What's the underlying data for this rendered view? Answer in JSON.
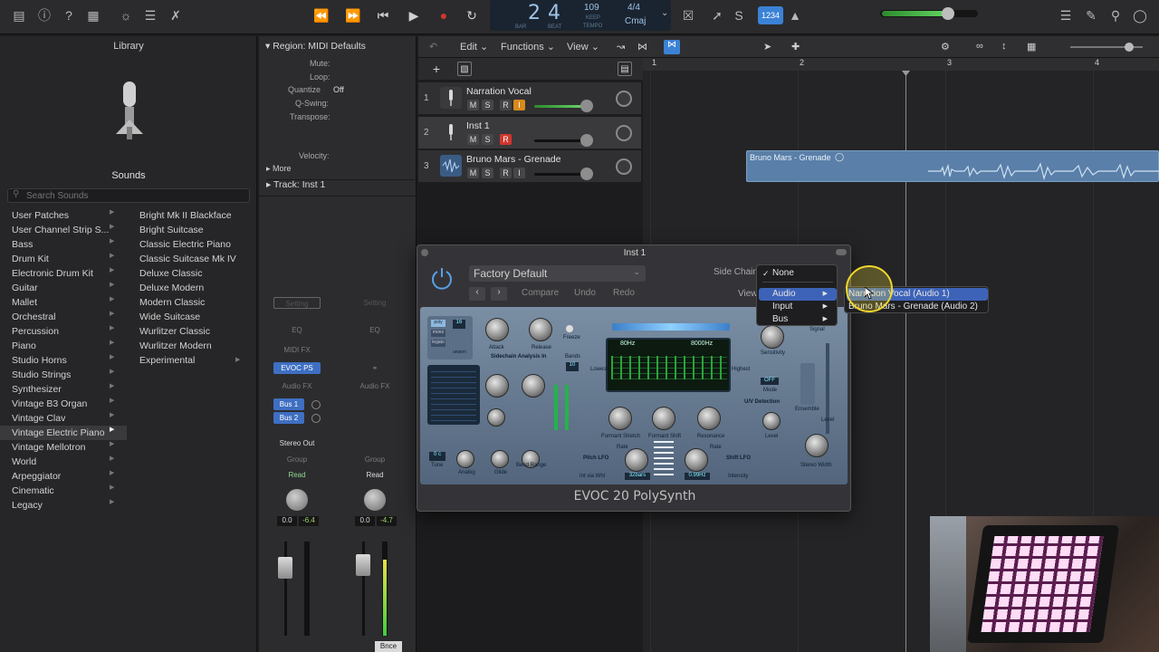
{
  "transport": {
    "bar": "2",
    "beat": "4",
    "bar_label": "BAR",
    "beat_label": "BEAT",
    "tempo": "109",
    "tempo_mode": "KEEP",
    "tempo_label": "TEMPO",
    "time_sig": "4/4",
    "key": "Cmaj",
    "counter_mode": "1234"
  },
  "library": {
    "title": "Library",
    "sounds_label": "Sounds",
    "search_placeholder": "Search Sounds",
    "categories": [
      "User Patches",
      "User Channel Strip S...",
      "Bass",
      "Drum Kit",
      "Electronic Drum Kit",
      "Guitar",
      "Mallet",
      "Orchestral",
      "Percussion",
      "Piano",
      "Studio Horns",
      "Studio Strings",
      "Synthesizer",
      "Vintage B3 Organ",
      "Vintage Clav",
      "Vintage Electric Piano",
      "Vintage Mellotron",
      "World",
      "Arpeggiator",
      "Cinematic",
      "Legacy"
    ],
    "patches": [
      "Bright Mk II Blackface",
      "Bright Suitcase",
      "Classic Electric Piano",
      "Classic Suitcase Mk IV",
      "Deluxe Classic",
      "Deluxe Modern",
      "Modern Classic",
      "Wide Suitcase",
      "Wurlitzer Classic",
      "Wurlitzer Modern",
      "Experimental"
    ]
  },
  "inspector": {
    "region_title": "Region: MIDI Defaults",
    "mute": "Mute:",
    "loop": "Loop:",
    "quantize": "Quantize",
    "quantize_value": "Off",
    "qswing": "Q-Swing:",
    "transpose": "Transpose:",
    "velocity": "Velocity:",
    "more": "More",
    "track_title": "Track:  Inst 1"
  },
  "strips": {
    "setting": "Setting",
    "eq": "EQ",
    "midi_fx": "MIDI FX",
    "instrument": "EVOC PS",
    "audio_fx": "Audio FX",
    "bus1": "Bus 1",
    "bus2": "Bus 2",
    "output": "Stereo Out",
    "group": "Group",
    "read": "Read",
    "left_pan": "0.0",
    "left_peak": "-6.4",
    "right_pan": "0.0",
    "right_peak": "-4.7",
    "bounce": "Bnce"
  },
  "tracks_menu": {
    "edit": "Edit",
    "functions": "Functions",
    "view": "View"
  },
  "tracks": [
    {
      "num": "1",
      "name": "Narration Vocal",
      "m": "M",
      "s": "S",
      "r": "R",
      "i": "I"
    },
    {
      "num": "2",
      "name": "Inst 1",
      "m": "M",
      "s": "S",
      "r": "R"
    },
    {
      "num": "3",
      "name": "Bruno Mars - Grenade",
      "m": "M",
      "s": "S",
      "r": "R",
      "i": "I"
    }
  ],
  "ruler": [
    "1",
    "2",
    "3",
    "4"
  ],
  "region": {
    "name": "Bruno Mars - Grenade"
  },
  "plugin": {
    "window_title": "Inst 1",
    "preset": "Factory Default",
    "compare": "Compare",
    "undo": "Undo",
    "redo": "Redo",
    "side_chain": "Side Chain:",
    "view": "View",
    "name": "EVOC 20 PolySynth",
    "labels": {
      "attack": "Attack",
      "release": "Release",
      "freeze": "Freeze",
      "bands": "Bands",
      "bands_value": "10",
      "lowest": "Lowest",
      "highest": "Highest",
      "low_freq": "80Hz",
      "high_freq": "8000Hz",
      "sensitivity": "Sensitivity",
      "signal": "Signal",
      "off": "OFF",
      "mode": "Mode",
      "uv_detection": "U/V Detection",
      "level": "Level",
      "ensemble": "Ensemble",
      "formant_stretch": "Formant Stretch",
      "formant_shift": "Formant Shift",
      "resonance": "Resonance",
      "pitch_lfo": "Pitch LFO",
      "shift_lfo": "Shift LFO",
      "rate": "Rate",
      "intensity": "Intensity",
      "stereo_width": "Stereo Width",
      "sidechain_in": "Sidechain Analysis In",
      "voices": "16",
      "bars_32": "32bars",
      "hz_099": "0.99Hz",
      "glide": "Glide",
      "bend_range": "Bend Range",
      "tune": "Tune",
      "analog": "Analog",
      "c0": "0 c",
      "int_via_whl": "Int via Whl",
      "poly": "poly",
      "mono": "mono",
      "legato": "legato",
      "unison": "unison"
    }
  },
  "sidechain_menu": {
    "none": "None",
    "audio": "Audio",
    "input": "Input",
    "bus": "Bus",
    "submenu": [
      "Narration Vocal (Audio 1)",
      "Bruno Mars - Grenade (Audio 2)"
    ]
  },
  "colors": {
    "accent": "#3b82d6",
    "record": "#d0372e",
    "region": "#5a7fa8",
    "highlight": "#3d63b8",
    "play": "#dcdcdc"
  }
}
